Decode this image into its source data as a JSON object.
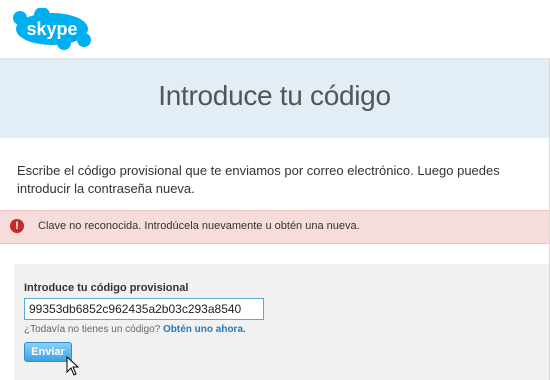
{
  "brand": {
    "logo_text": "skype",
    "color": "#00aff0"
  },
  "header": {
    "title": "Introduce tu código"
  },
  "instructions": "Escribe el código provisional que te enviamos por correo electrónico. Luego puedes introducir la contraseña nueva.",
  "error": {
    "icon": "error-icon",
    "icon_glyph": "!",
    "message": "Clave no reconocida. Introdúcela nuevamente u obtén una nueva.",
    "color": "#c42b2b"
  },
  "form": {
    "label": "Introduce tu código provisional",
    "code_value": "99353db6852c962435a2b03c293a8540",
    "hint_text": "¿Todavía no tienes un código?",
    "hint_link": "Obtén uno ahora.",
    "submit_label": "Enviar"
  }
}
